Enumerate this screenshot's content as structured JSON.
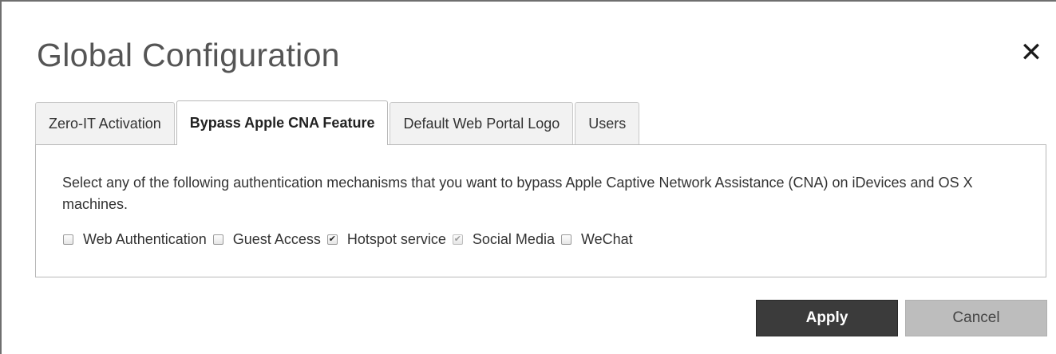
{
  "dialog": {
    "title": "Global Configuration",
    "close_icon": "close-icon"
  },
  "tabs": [
    {
      "label": "Zero-IT Activation",
      "active": false
    },
    {
      "label": "Bypass Apple CNA Feature",
      "active": true
    },
    {
      "label": "Default Web Portal Logo",
      "active": false
    },
    {
      "label": "Users",
      "active": false
    }
  ],
  "panel": {
    "description": "Select any of the following authentication mechanisms that you want to bypass Apple Captive Network Assistance (CNA) on iDevices and OS X machines.",
    "options": [
      {
        "label": "Web Authentication",
        "checked": false
      },
      {
        "label": "Guest Access",
        "checked": false
      },
      {
        "label": "Hotspot service",
        "checked": true
      },
      {
        "label": "Social Media",
        "checked": true,
        "disabled": true
      },
      {
        "label": "WeChat",
        "checked": false
      }
    ]
  },
  "buttons": {
    "apply_label": "Apply",
    "cancel_label": "Cancel"
  },
  "colors": {
    "apply_bg": "#3b3b3b",
    "cancel_bg": "#bdbdbd",
    "title_text": "#555555"
  }
}
